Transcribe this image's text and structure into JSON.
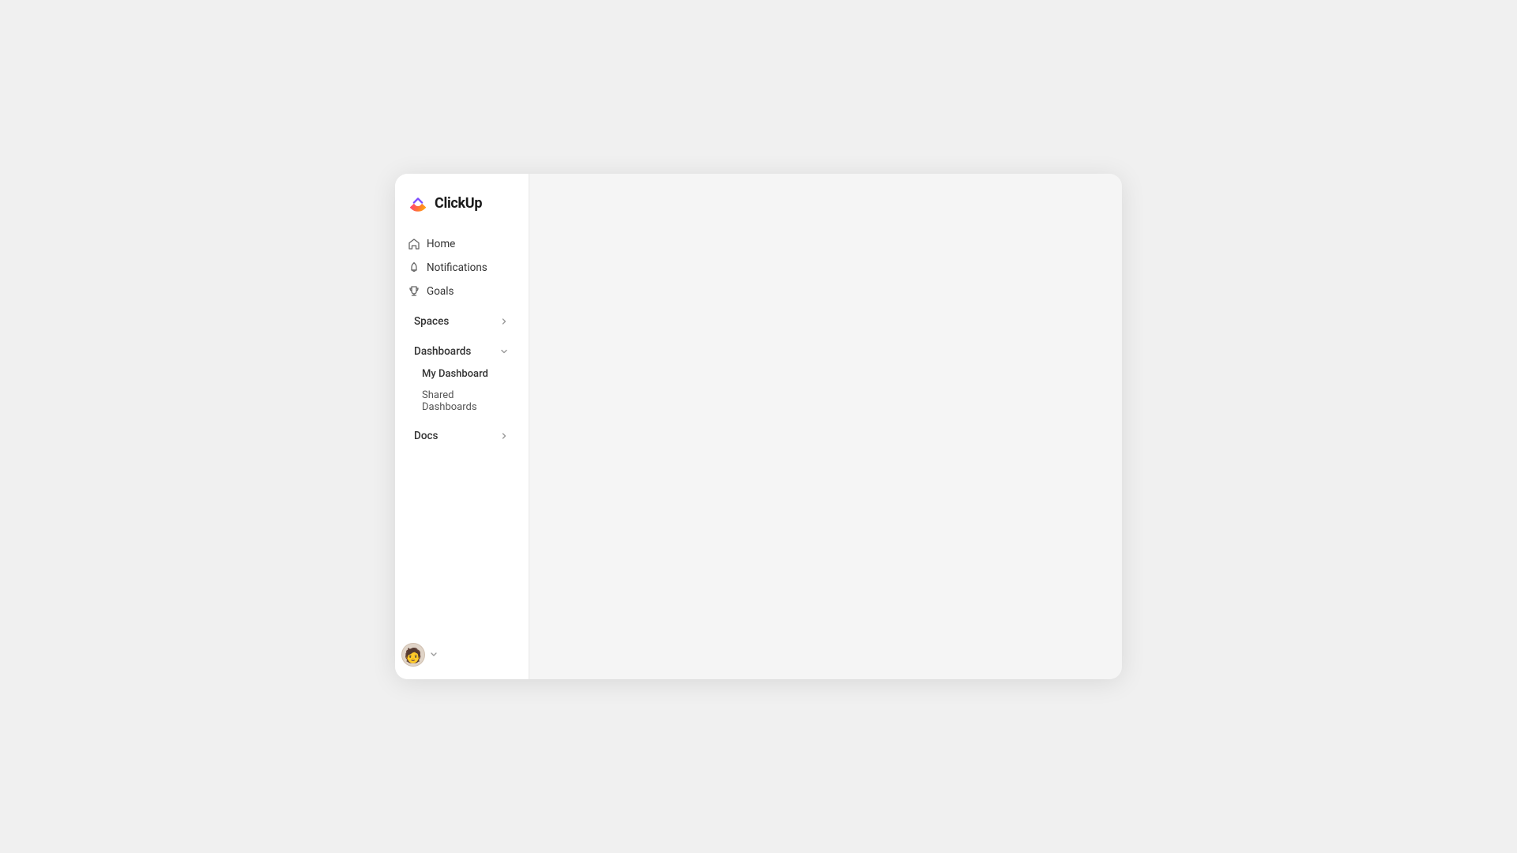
{
  "app": {
    "name": "ClickUp"
  },
  "sidebar": {
    "nav_items": [
      {
        "id": "home",
        "label": "Home",
        "icon": "home"
      },
      {
        "id": "notifications",
        "label": "Notifications",
        "icon": "bell"
      },
      {
        "id": "goals",
        "label": "Goals",
        "icon": "trophy"
      }
    ],
    "groups": [
      {
        "id": "spaces",
        "label": "Spaces",
        "expanded": false,
        "chevron": "right",
        "children": []
      },
      {
        "id": "dashboards",
        "label": "Dashboards",
        "expanded": true,
        "chevron": "down",
        "children": [
          {
            "id": "my-dashboard",
            "label": "My Dashboard",
            "bold": true
          },
          {
            "id": "shared-dashboards",
            "label": "Shared Dashboards",
            "bold": false
          }
        ]
      },
      {
        "id": "docs",
        "label": "Docs",
        "expanded": false,
        "chevron": "right",
        "children": []
      }
    ]
  },
  "user": {
    "avatar_emoji": "🧑"
  }
}
